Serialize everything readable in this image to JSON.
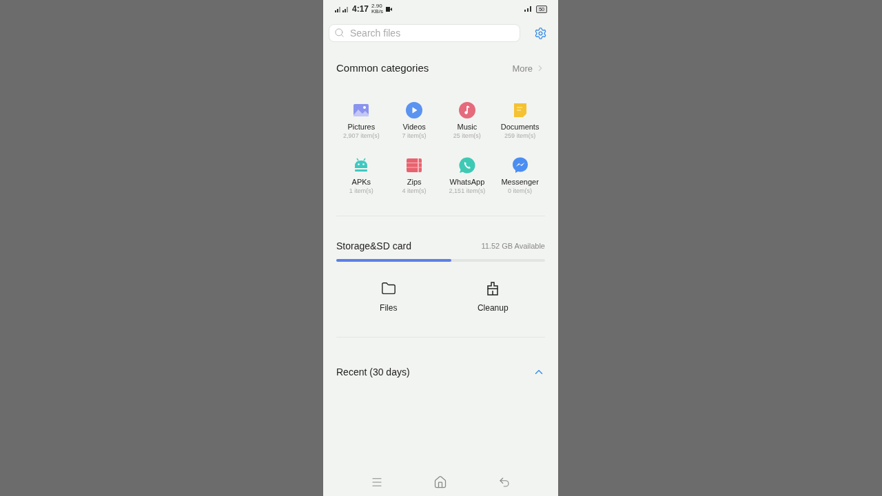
{
  "status_bar": {
    "time": "4:17",
    "speed": "2.90",
    "speed_unit": "KB/s",
    "battery": "50"
  },
  "search": {
    "placeholder": "Search files"
  },
  "categories": {
    "title": "Common categories",
    "more": "More",
    "items": [
      {
        "kind": "pictures",
        "name": "Pictures",
        "count": "2,907 item(s)"
      },
      {
        "kind": "videos",
        "name": "Videos",
        "count": "7 item(s)"
      },
      {
        "kind": "music",
        "name": "Music",
        "count": "25 item(s)"
      },
      {
        "kind": "documents",
        "name": "Documents",
        "count": "259 item(s)"
      },
      {
        "kind": "apks",
        "name": "APKs",
        "count": "1 item(s)"
      },
      {
        "kind": "zips",
        "name": "Zips",
        "count": "4 item(s)"
      },
      {
        "kind": "whatsapp",
        "name": "WhatsApp",
        "count": "2,151 item(s)"
      },
      {
        "kind": "messenger",
        "name": "Messenger",
        "count": "0 item(s)"
      }
    ]
  },
  "storage": {
    "title": "Storage&SD card",
    "available": "11.52 GB Available",
    "level": 0.55,
    "actions": [
      {
        "kind": "files",
        "label": "Files"
      },
      {
        "kind": "cleanup",
        "label": "Cleanup"
      }
    ]
  },
  "recent": {
    "title": "Recent (30 days)",
    "expanded": true
  }
}
